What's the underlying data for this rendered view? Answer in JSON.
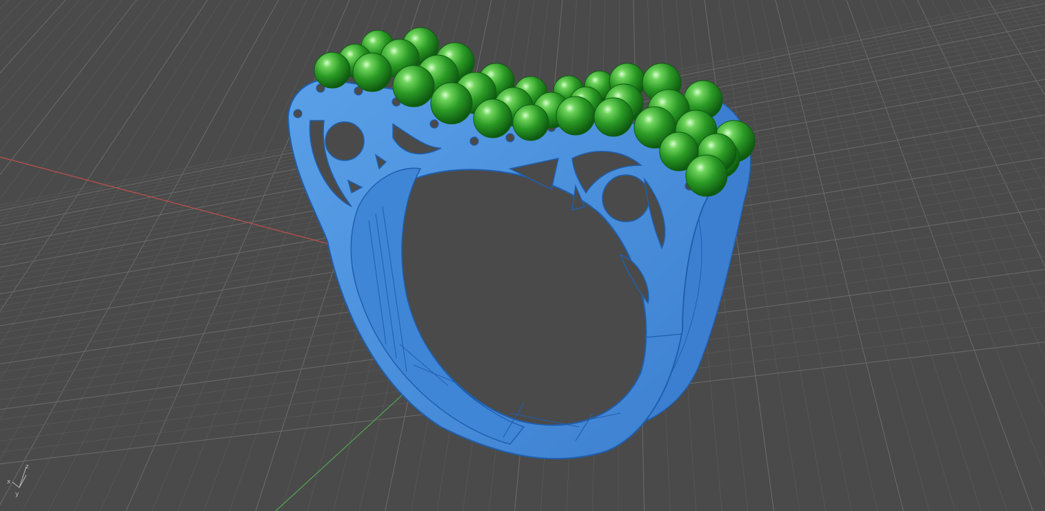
{
  "viewport": {
    "background": "#4a4a4a",
    "grid_minor_color": "#5a5a5a",
    "grid_major_color": "#6b6b6b",
    "x_axis_color": "#c0504d",
    "y_axis_color": "#4fa84f"
  },
  "model": {
    "ring_color": "#4a8fd6",
    "ring_edge_color": "#1f5fae",
    "gem_color": "#2fae2a",
    "gem_highlight": "#bff5b0"
  },
  "axis_widget": {
    "x_label": "x",
    "y_label": "y",
    "z_label": "z"
  }
}
